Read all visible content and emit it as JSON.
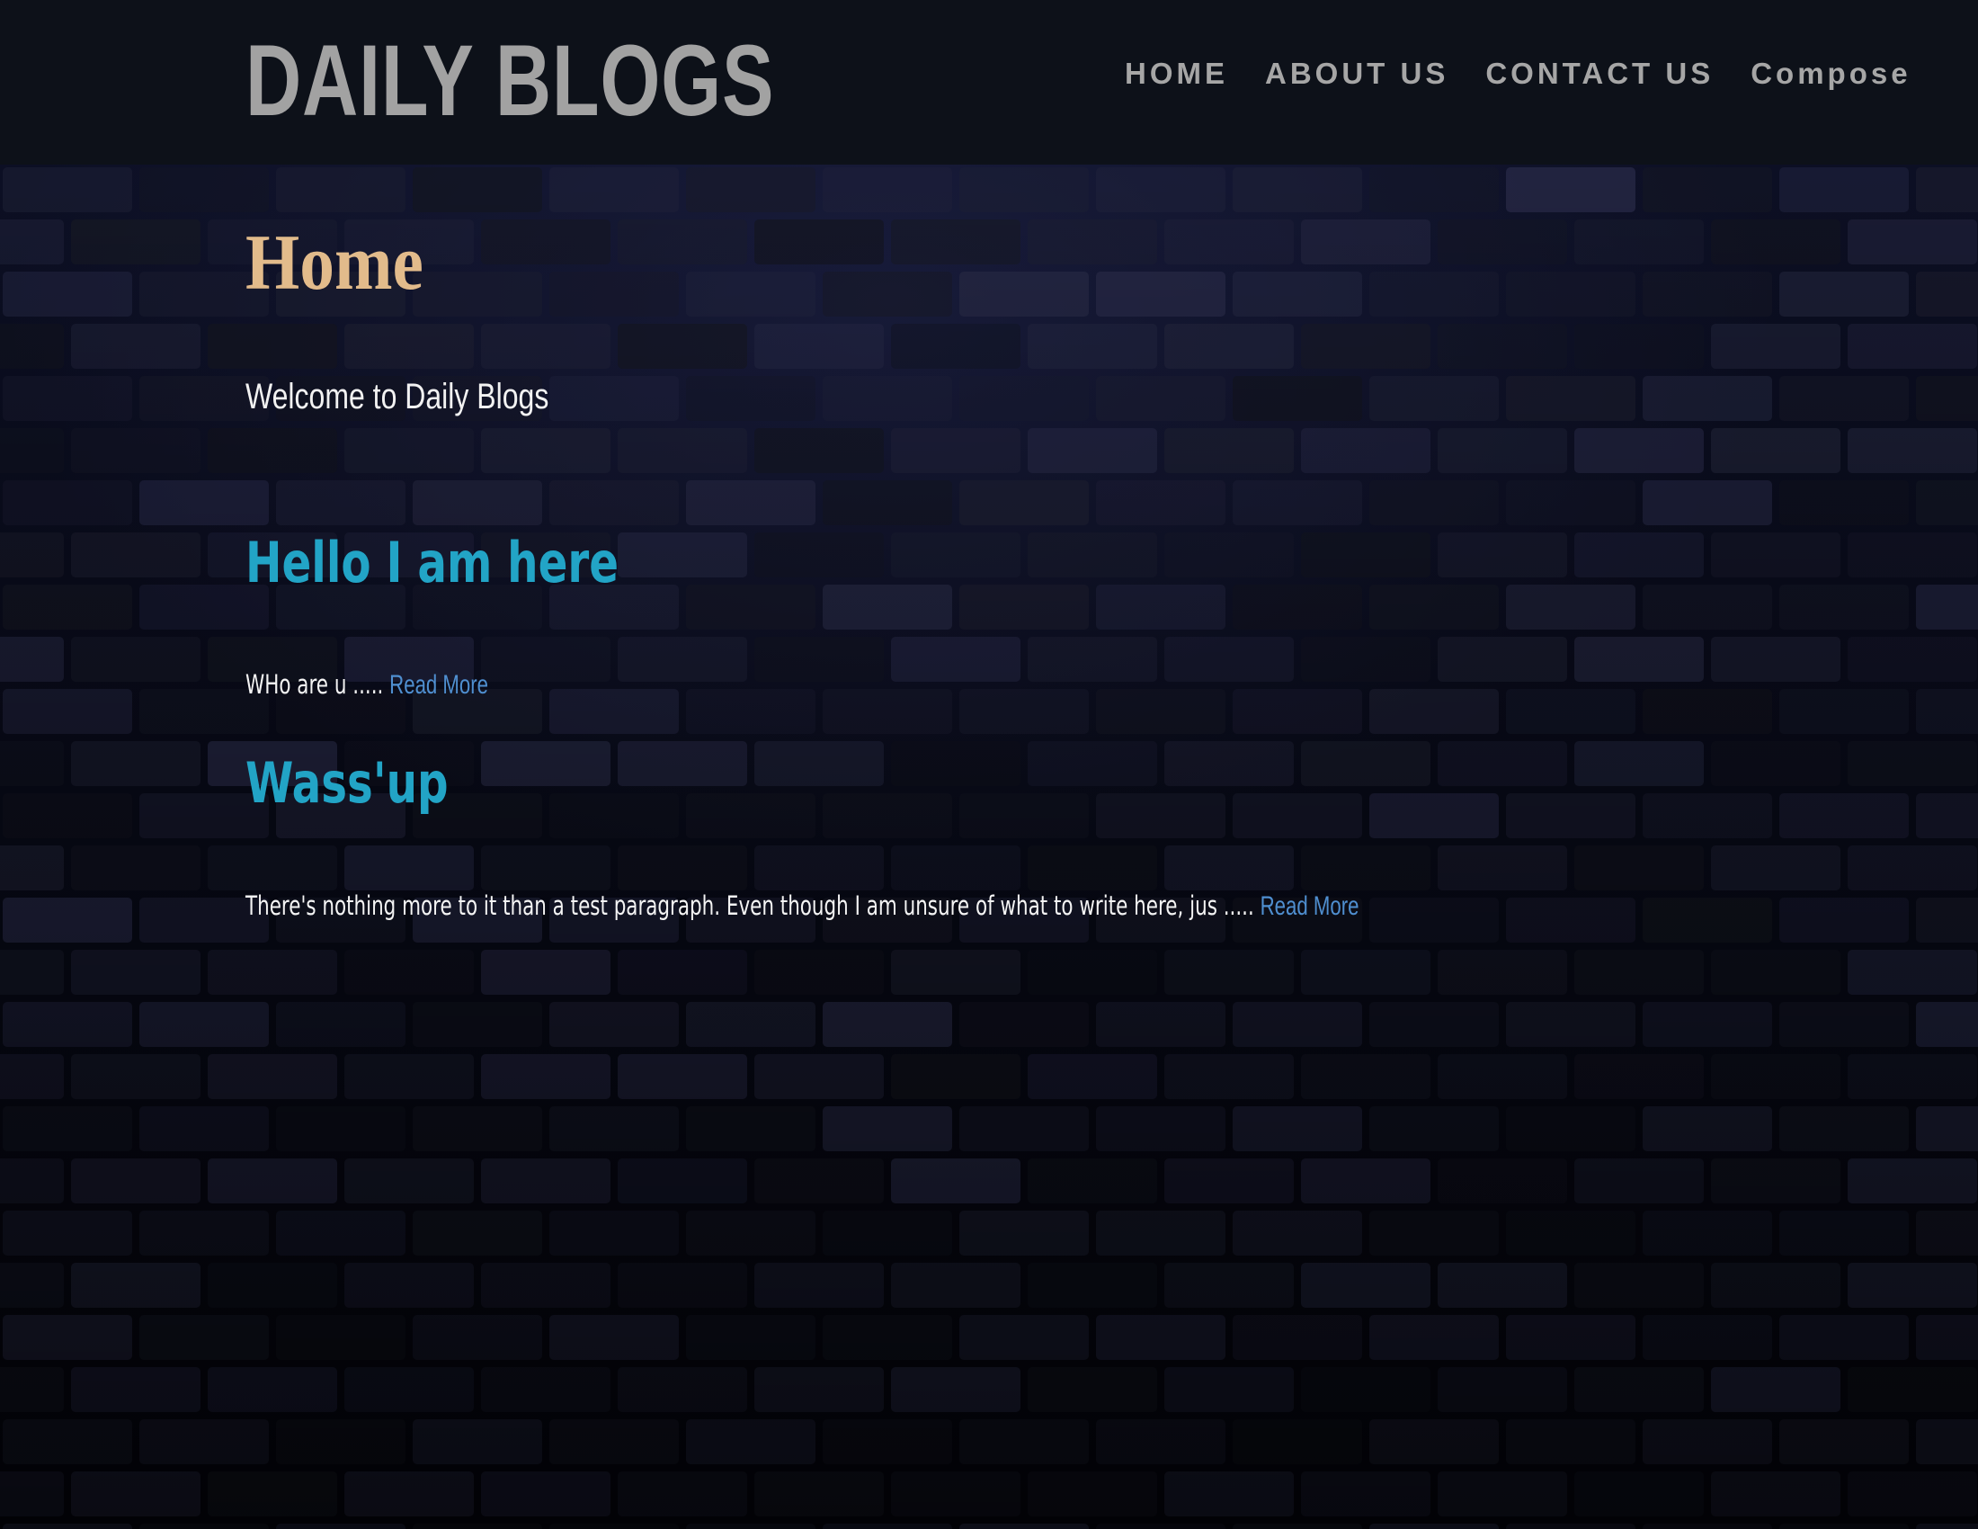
{
  "header": {
    "brand": "DAILY BLOGS",
    "nav": [
      {
        "label": "HOME"
      },
      {
        "label": "ABOUT US"
      },
      {
        "label": "CONTACT US"
      },
      {
        "label": "Compose"
      }
    ]
  },
  "main": {
    "title": "Home",
    "welcome": "Welcome to Daily Blogs",
    "posts": [
      {
        "title": "Hello I am here",
        "excerpt": "WHo are u .....",
        "read_more": "Read More"
      },
      {
        "title": "Wass'up",
        "excerpt": "There's nothing more to it than a test paragraph. Even though I am unsure of what to write here, jus .....",
        "read_more": "Read More"
      }
    ]
  },
  "colors": {
    "header_bg": "#0d1119",
    "brand_text": "#a2a2a2",
    "nav_text": "#a6a6a6",
    "title_gold": "#e2bb8b",
    "post_title_cyan": "#22a4c6",
    "link_blue": "#4f8fd0",
    "body_text": "#f4f4f4"
  }
}
